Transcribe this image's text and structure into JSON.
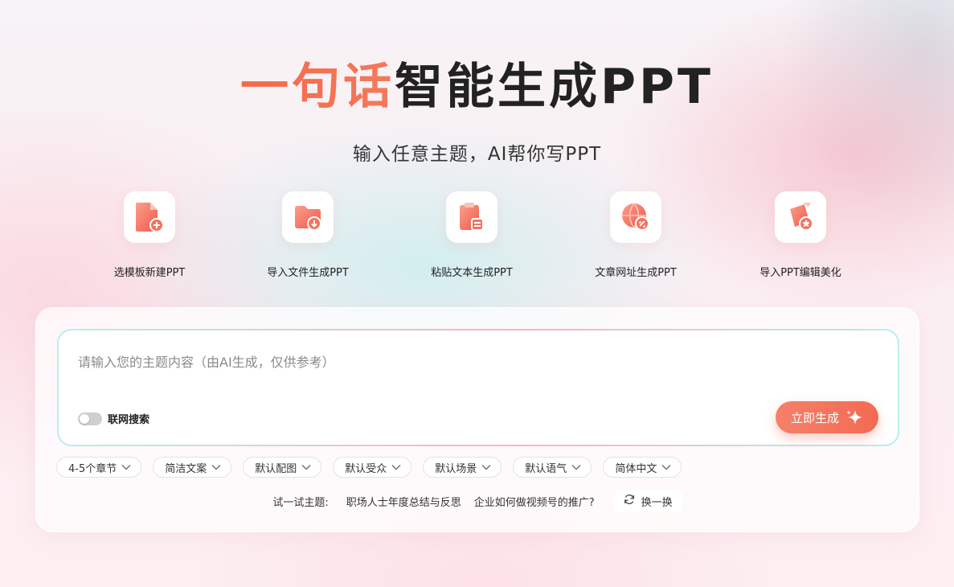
{
  "header": {
    "title_highlight": "一句话",
    "title_rest": "智能生成PPT",
    "subtitle": "输入任意主题，AI帮你写PPT"
  },
  "features": [
    {
      "label": "选模板新建PPT",
      "icon": "new-file-plus-icon"
    },
    {
      "label": "导入文件生成PPT",
      "icon": "folder-import-icon"
    },
    {
      "label": "粘贴文本生成PPT",
      "icon": "clipboard-paste-icon"
    },
    {
      "label": "文章网址生成PPT",
      "icon": "globe-link-icon"
    },
    {
      "label": "导入PPT编辑美化",
      "icon": "brush-star-icon"
    }
  ],
  "input": {
    "placeholder": "请输入您的主题内容（由AI生成，仅供参考）",
    "value": ""
  },
  "web_search": {
    "label": "联网搜索",
    "enabled": false
  },
  "generate_button": {
    "label": "立即生成",
    "icon": "sparkle-icon"
  },
  "options": [
    "4-5个章节",
    "简洁文案",
    "默认配图",
    "默认受众",
    "默认场景",
    "默认语气",
    "简体中文"
  ],
  "suggestions": {
    "lead": "试一试主题:",
    "topics": [
      "职场人士年度总结与反思",
      "企业如何做视频号的推广?"
    ],
    "refresh_label": "换一换"
  },
  "colors": {
    "accent": "#f36a52",
    "accent_light": "#f5806a",
    "title_dark": "#222222"
  }
}
